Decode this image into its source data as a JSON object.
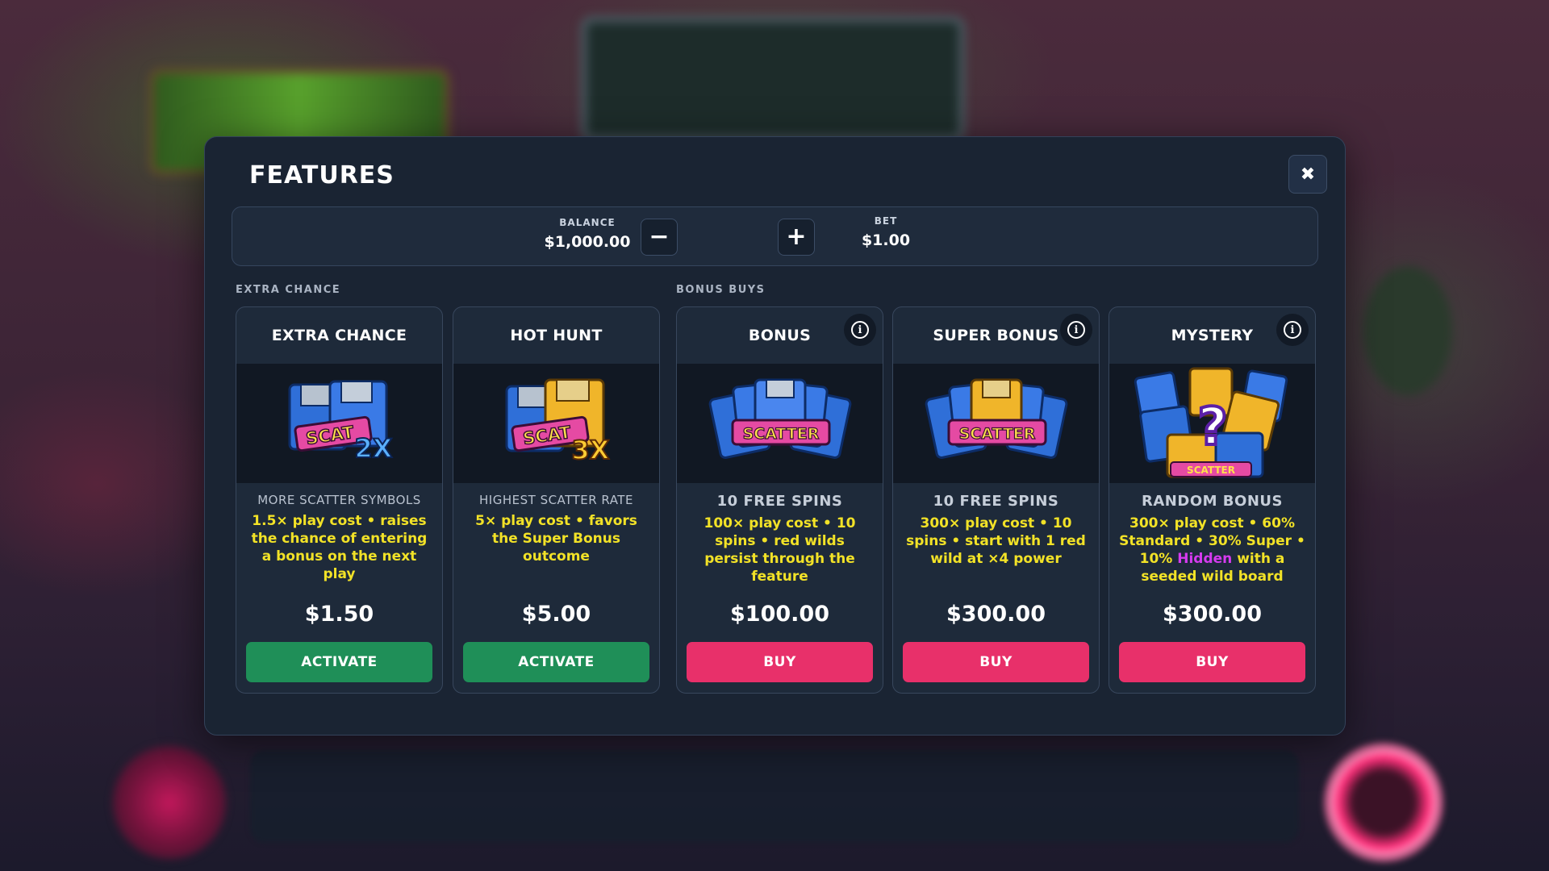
{
  "modal": {
    "title": "FEATURES",
    "close_icon": "close-icon"
  },
  "wallet": {
    "balance_label": "BALANCE",
    "balance_value": "$1,000.00",
    "bet_label": "BET",
    "bet_value": "$1.00",
    "decrease_icon": "minus-icon",
    "increase_icon": "plus-icon"
  },
  "sections": {
    "extra_chance": "EXTRA CHANCE",
    "bonus_buys": "BONUS BUYS"
  },
  "cards": [
    {
      "title": "EXTRA CHANCE",
      "subtitle": "MORE SCATTER SYMBOLS",
      "description": "1.5× play cost • raises the chance of entering a bonus on the next play",
      "price": "$1.50",
      "button": "ACTIVATE",
      "image_badge": "2X",
      "image_text": "SCAT"
    },
    {
      "title": "HOT HUNT",
      "subtitle": "HIGHEST SCATTER RATE",
      "description": "5× play cost • favors the Super Bonus outcome",
      "price": "$5.00",
      "button": "ACTIVATE",
      "image_badge": "3X",
      "image_text": "SCAT"
    },
    {
      "title": "BONUS",
      "subtitle": "10 FREE SPINS",
      "description": "100× play cost • 10 spins • red wilds persist through the feature",
      "price": "$100.00",
      "button": "BUY",
      "image_text": "SCATTER"
    },
    {
      "title": "SUPER BONUS",
      "subtitle": "10 FREE SPINS",
      "description": "300× play cost • 10 spins • start with 1 red wild at ×4 power",
      "price": "$300.00",
      "button": "BUY",
      "image_text": "SCATTER"
    },
    {
      "title": "MYSTERY",
      "subtitle": "RANDOM BONUS",
      "description_before": "300× play cost • 60% Standard • 30% Super • 10% ",
      "description_highlight": "Hidden",
      "description_after": " with a seeded wild board",
      "price": "$300.00",
      "button": "BUY",
      "image_text": "SCATTER",
      "image_mark": "?"
    }
  ],
  "colors": {
    "activate": "#1f8f58",
    "buy": "#e8306a",
    "description": "#f2e227",
    "highlight": "#d63bf0"
  }
}
